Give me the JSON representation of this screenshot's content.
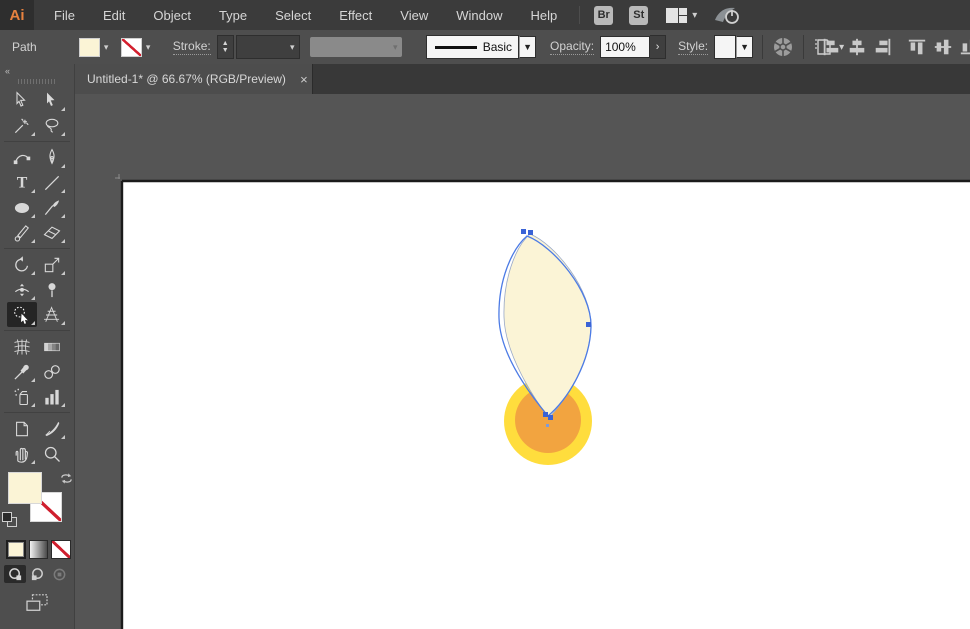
{
  "app": {
    "logo": "Ai"
  },
  "menubar": {
    "items": [
      "File",
      "Edit",
      "Object",
      "Type",
      "Select",
      "Effect",
      "View",
      "Window",
      "Help"
    ],
    "bridge_label": "Br",
    "stock_label": "St"
  },
  "controlbar": {
    "selection_label": "Path",
    "stroke_label": "Stroke:",
    "brush_value": "Basic",
    "opacity_label": "Opacity:",
    "opacity_value": "100%",
    "style_label": "Style:",
    "fill_color": "#fbf4d6"
  },
  "tab": {
    "title": "Untitled-1* @ 66.67% (RGB/Preview)",
    "close_glyph": "×"
  },
  "toolbar": {
    "collapse_glyph": "«",
    "groups": [
      [
        {
          "name": "selection-tool",
          "icon": "sel-o",
          "fly": false,
          "sel": false
        },
        {
          "name": "direct-selection-tool",
          "icon": "sel-f",
          "fly": true,
          "sel": false
        },
        {
          "name": "magic-wand-tool",
          "icon": "wand",
          "fly": true,
          "sel": false
        },
        {
          "name": "lasso-tool",
          "icon": "lasso",
          "fly": true,
          "sel": false
        }
      ],
      [
        {
          "name": "curvature-tool",
          "icon": "curv",
          "fly": false,
          "sel": false
        },
        {
          "name": "pen-tool",
          "icon": "pen",
          "fly": true,
          "sel": false
        },
        {
          "name": "type-tool",
          "icon": "type",
          "fly": true,
          "sel": false
        },
        {
          "name": "line-segment-tool",
          "icon": "line",
          "fly": true,
          "sel": false
        },
        {
          "name": "ellipse-tool",
          "icon": "ellipse",
          "fly": true,
          "sel": false
        },
        {
          "name": "paintbrush-tool",
          "icon": "brush",
          "fly": true,
          "sel": false
        },
        {
          "name": "shaper-tool",
          "icon": "shaper",
          "fly": true,
          "sel": false
        },
        {
          "name": "eraser-tool",
          "icon": "eraser",
          "fly": true,
          "sel": false
        }
      ],
      [
        {
          "name": "rotate-tool",
          "icon": "rotate",
          "fly": true,
          "sel": false
        },
        {
          "name": "scale-tool",
          "icon": "scale",
          "fly": true,
          "sel": false
        },
        {
          "name": "width-tool",
          "icon": "width",
          "fly": true,
          "sel": false
        },
        {
          "name": "puppet-warp-tool",
          "icon": "puppet",
          "fly": false,
          "sel": false
        },
        {
          "name": "shape-builder-tool",
          "icon": "builder",
          "fly": true,
          "sel": true
        },
        {
          "name": "perspective-grid-tool",
          "icon": "persp",
          "fly": true,
          "sel": false
        }
      ],
      [
        {
          "name": "mesh-tool",
          "icon": "mesh",
          "fly": false,
          "sel": false
        },
        {
          "name": "gradient-tool",
          "icon": "grad",
          "fly": false,
          "sel": false
        },
        {
          "name": "eyedropper-tool",
          "icon": "eyed",
          "fly": true,
          "sel": false
        },
        {
          "name": "blend-tool",
          "icon": "blend",
          "fly": false,
          "sel": false
        },
        {
          "name": "symbol-sprayer-tool",
          "icon": "spray",
          "fly": true,
          "sel": false
        },
        {
          "name": "column-graph-tool",
          "icon": "graph",
          "fly": true,
          "sel": false
        }
      ],
      [
        {
          "name": "artboard-tool",
          "icon": "artb",
          "fly": false,
          "sel": false
        },
        {
          "name": "slice-tool",
          "icon": "slice",
          "fly": true,
          "sel": false
        },
        {
          "name": "hand-tool",
          "icon": "hand",
          "fly": true,
          "sel": false
        },
        {
          "name": "zoom-tool",
          "icon": "zoom",
          "fly": false,
          "sel": false
        }
      ]
    ]
  },
  "canvas": {
    "petal_fill": "#fbf4d6",
    "petal_edge": "#98a8c8",
    "selection_blue": "#4c7be5",
    "anchor_blue": "#3a63d6",
    "ring_yellow": "#ffdd3d",
    "circle_orange": "#f2a440",
    "artboard_white": "#ffffff"
  }
}
